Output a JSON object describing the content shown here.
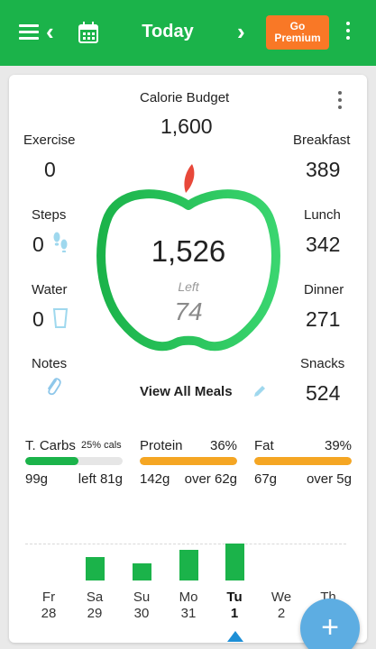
{
  "header": {
    "title": "Today",
    "premium_line1": "Go",
    "premium_line2": "Premium"
  },
  "budget": {
    "label": "Calorie Budget",
    "value": "1,600"
  },
  "left_stats": [
    {
      "label": "Exercise",
      "value": "0"
    },
    {
      "label": "Steps",
      "value": "0"
    },
    {
      "label": "Water",
      "value": "0"
    },
    {
      "label": "Notes",
      "value": ""
    }
  ],
  "meals": [
    {
      "label": "Breakfast",
      "value": "389"
    },
    {
      "label": "Lunch",
      "value": "342"
    },
    {
      "label": "Dinner",
      "value": "271"
    },
    {
      "label": "Snacks",
      "value": "524"
    }
  ],
  "apple": {
    "consumed": "1,526",
    "left_label": "Left",
    "left_value": "74"
  },
  "view_all_meals": "View All Meals",
  "macros": [
    {
      "name": "T. Carbs",
      "pct": "25% cals",
      "amount": "99g",
      "status": "left 81g",
      "fill_fraction": 0.55,
      "color": "#1bb34a"
    },
    {
      "name": "Protein",
      "pct": "36%",
      "amount": "142g",
      "status": "over 62g",
      "fill_fraction": 1.0,
      "color": "#f5a623"
    },
    {
      "name": "Fat",
      "pct": "39%",
      "amount": "67g",
      "status": "over 5g",
      "fill_fraction": 1.0,
      "color": "#f5a623"
    }
  ],
  "week": {
    "days": [
      {
        "name": "Fr",
        "date": "28",
        "value": 0
      },
      {
        "name": "Sa",
        "date": "29",
        "value": 0.62
      },
      {
        "name": "Su",
        "date": "30",
        "value": 0.45
      },
      {
        "name": "Mo",
        "date": "31",
        "value": 0.82
      },
      {
        "name": "Tu",
        "date": "1",
        "value": 0.98,
        "active": true
      },
      {
        "name": "We",
        "date": "2",
        "value": 0
      },
      {
        "name": "Th",
        "date": "",
        "value": 0
      }
    ]
  },
  "colors": {
    "brand": "#1bb34a",
    "premium": "#f97826",
    "over": "#f5a623",
    "fab": "#5dade2"
  }
}
